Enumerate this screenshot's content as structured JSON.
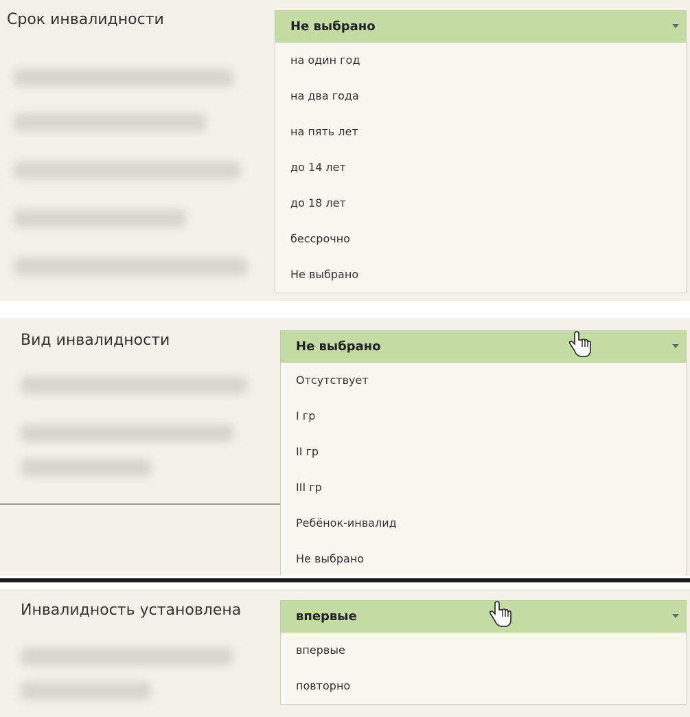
{
  "sections": [
    {
      "label": "Срок инвалидности",
      "selected": "Не выбрано",
      "options": [
        "на один год",
        "на два года",
        "на пять лет",
        "до 14 лет",
        "до 18 лет",
        "бессрочно",
        "Не выбрано"
      ]
    },
    {
      "label": "Вид инвалидности",
      "selected": "Не выбрано",
      "options": [
        "Отсутствует",
        "I гр",
        "II гр",
        "III гр",
        "Ребёнок-инвалид",
        "Не выбрано"
      ]
    },
    {
      "label": "Инвалидность установлена",
      "selected": "впервые",
      "options": [
        "впервые",
        "повторно"
      ]
    }
  ],
  "colors": {
    "panel_bg": "#f3f1e8",
    "dropdown_header_bg": "#c4dca4",
    "list_bg": "#f8f7f0"
  },
  "icons": [
    "chevron-down-icon",
    "hand-cursor-icon"
  ]
}
